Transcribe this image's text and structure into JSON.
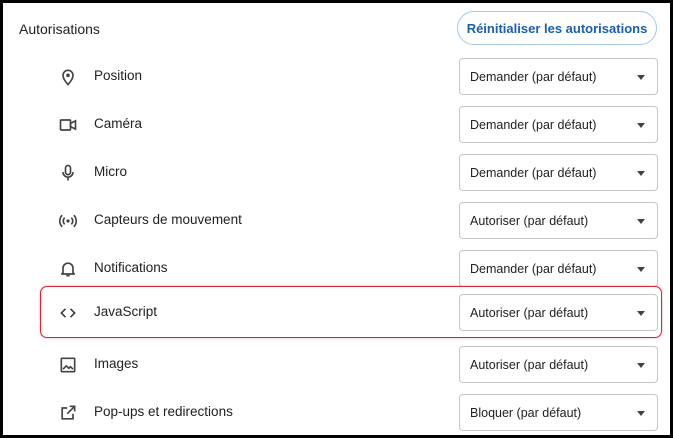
{
  "section": {
    "title": "Autorisations",
    "reset_label": "Réinitialiser les autorisations"
  },
  "colors": {
    "accent": "#1a5fb4",
    "highlight": "#d9243a"
  },
  "permissions": [
    {
      "label": "Position",
      "icon": "location-pin-icon",
      "value": "Demander (par défaut)"
    },
    {
      "label": "Caméra",
      "icon": "camera-icon",
      "value": "Demander (par défaut)"
    },
    {
      "label": "Micro",
      "icon": "microphone-icon",
      "value": "Demander (par défaut)"
    },
    {
      "label": "Capteurs de mouvement",
      "icon": "motion-sensor-icon",
      "value": "Autoriser (par défaut)"
    },
    {
      "label": "Notifications",
      "icon": "bell-icon",
      "value": "Demander (par défaut)"
    },
    {
      "label": "JavaScript",
      "icon": "code-icon",
      "value": "Autoriser (par défaut)"
    },
    {
      "label": "Images",
      "icon": "image-icon",
      "value": "Autoriser (par défaut)"
    },
    {
      "label": "Pop-ups et redirections",
      "icon": "external-link-icon",
      "value": "Bloquer (par défaut)"
    }
  ]
}
